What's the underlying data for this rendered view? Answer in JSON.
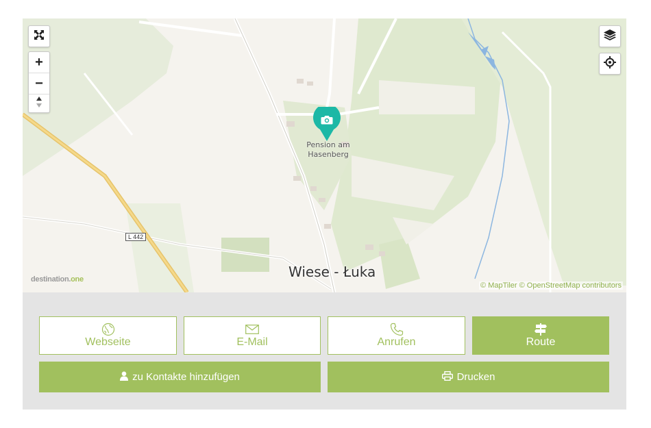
{
  "map": {
    "marker_label_line1": "Pension am",
    "marker_label_line2": "Hasenberg",
    "town_label": "Wiese - Łuka",
    "road_sign": "L 442",
    "brand_text": "destination.",
    "brand_suffix": "one",
    "attribution": "© MapTiler © OpenStreetMap contributors",
    "controls": {
      "fullscreen_icon": "expand-arrows-icon",
      "zoom_in": "+",
      "zoom_out": "−",
      "compass_icon": "compass-arrows-icon",
      "layers_icon": "layers-icon",
      "locate_icon": "crosshair-icon"
    },
    "colors": {
      "marker": "#1cb8a6",
      "accent": "#a1c05e",
      "water": "#8cb6e0"
    }
  },
  "actions": {
    "webseite": {
      "label": "Webseite",
      "icon": "globe-icon"
    },
    "email": {
      "label": "E-Mail",
      "icon": "envelope-icon"
    },
    "anrufen": {
      "label": "Anrufen",
      "icon": "phone-icon"
    },
    "route": {
      "label": "Route",
      "icon": "signpost-icon"
    },
    "kontakte": {
      "label": "zu Kontakte hinzufügen",
      "icon": "user-icon"
    },
    "drucken": {
      "label": "Drucken",
      "icon": "printer-icon"
    }
  }
}
